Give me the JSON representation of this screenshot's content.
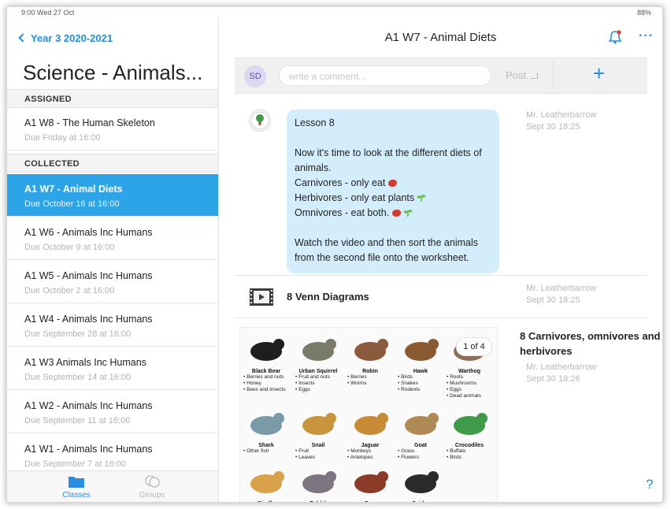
{
  "status": {
    "left": "9:00  Wed 27 Oct",
    "right": "88%"
  },
  "sidebar": {
    "back_label": "Year 3 2020-2021",
    "class_title": "Science - Animals...",
    "assigned_header": "ASSIGNED",
    "collected_header": "COLLECTED",
    "assigned": [
      {
        "title": "A1 W8 - The Human Skeleton",
        "due": "Due Friday at 16:00"
      }
    ],
    "collected": [
      {
        "title": "A1 W7 - Animal Diets",
        "due": "Due October 16 at 16:00",
        "selected": true
      },
      {
        "title": "A1 W6 - Animals Inc Humans",
        "due": "Due October 9 at 16:00"
      },
      {
        "title": "A1 W5 - Animals Inc Humans",
        "due": "Due October 2 at 16:00"
      },
      {
        "title": "A1 W4 - Animals Inc Humans",
        "due": "Due September 28 at 16:00"
      },
      {
        "title": "A1 W3 Animals Inc Humans",
        "due": "Due September 14 at 16:00"
      },
      {
        "title": "A1 W2 - Animals Inc Humans",
        "due": "Due September 11 at 16:00"
      },
      {
        "title": "A1 W1 - Animals Inc Humans",
        "due": "Due September 7 at 16:00"
      }
    ],
    "tabs": [
      {
        "label": "Classes",
        "active": true,
        "icon": "folder-icon"
      },
      {
        "label": "Groups",
        "active": false,
        "icon": "chat-bubbles-icon"
      }
    ]
  },
  "main": {
    "title": "A1 W7 - Animal Diets",
    "comment": {
      "avatar_initials": "SD",
      "placeholder": "write a comment...",
      "post_label": "Post"
    },
    "posts": [
      {
        "author": "Mr. Leatherbarrow",
        "time": "Sept 30 18:25",
        "lines": [
          "Lesson 8",
          "",
          "Now it's time to look at the different diets of animals.",
          "Carnivores - only eat",
          "Herbivores - only eat plants",
          "Omnivores - eat both.",
          "",
          "Watch the video and then sort the animals from the second file onto the worksheet."
        ]
      },
      {
        "type": "video",
        "title": "8 Venn Diagrams",
        "author": "Mr. Leatherbarrow",
        "time": "Sept 30 18:25"
      },
      {
        "type": "document",
        "title": "8 Carnivores, omnivores and herbivores",
        "author": "Mr. Leatherbarrow",
        "time": "Sept 30 18:26",
        "pager": "1 of 4"
      }
    ],
    "worksheet": [
      {
        "name": "Black Bear",
        "diet": "• Berries and nuts\n• Honey\n• Bees and insects",
        "color": "#1e1e1e"
      },
      {
        "name": "Urban Squirrel",
        "diet": "• Fruit and nuts\n• Insects\n• Eggs",
        "color": "#7a7a6a"
      },
      {
        "name": "Robin",
        "diet": "• Berries\n• Worms",
        "color": "#8b5a3c"
      },
      {
        "name": "Hawk",
        "diet": "• Birds\n• Snakes\n• Rodents",
        "color": "#8a5a32"
      },
      {
        "name": "Warthog",
        "diet": "• Roots\n• Mushrooms\n• Eggs\n• Dead animals",
        "color": "#8c6e5a"
      },
      {
        "name": "Shark",
        "diet": "• Other fish",
        "color": "#7b9aa8"
      },
      {
        "name": "Snail",
        "diet": "• Fruit\n• Leaves",
        "color": "#c9953c"
      },
      {
        "name": "Jaguar",
        "diet": "• Monkeys\n• Antelopes",
        "color": "#c98a35"
      },
      {
        "name": "Goat",
        "diet": "• Grass\n• Flowers",
        "color": "#b08a55"
      },
      {
        "name": "Crocodiles",
        "diet": "• Buffalo\n• Birds",
        "color": "#3f9a4a"
      },
      {
        "name": "Giraffe",
        "diet": "",
        "color": "#d9a24a"
      },
      {
        "name": "Rabbit",
        "diet": "",
        "color": "#7d7680"
      },
      {
        "name": "Cow",
        "diet": "",
        "color": "#8a3c28"
      },
      {
        "name": "Spider",
        "diet": "",
        "color": "#2a2a2a"
      }
    ],
    "help_label": "?"
  },
  "colors": {
    "accent": "#1d8fe1",
    "selected": "#2ea4e8",
    "bubble": "#d4edfa"
  }
}
